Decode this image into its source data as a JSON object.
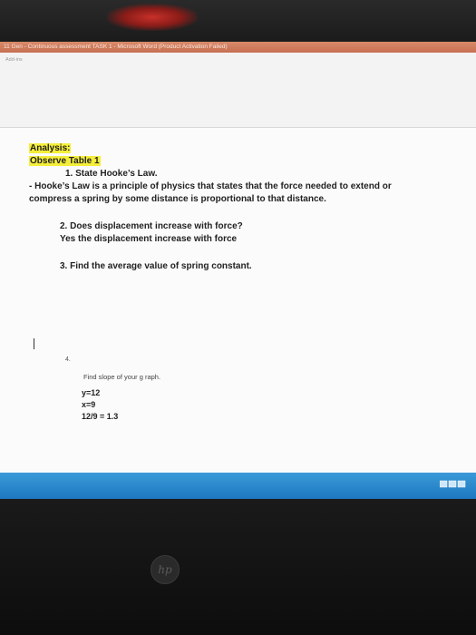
{
  "titlebar": {
    "text": "11 Gen - Continuous assessment TASK 1 - Microsoft Word (Product Activation Failed)"
  },
  "ribbon": {
    "label": "Add-ins"
  },
  "document": {
    "heading1": "Analysis:",
    "heading2": "Observe Table 1",
    "q1": "1.  State Hooke’s Law.",
    "a1_line1": "- Hooke’s Law is a principle of physics that states that the force needed to extend or",
    "a1_line2": "compress a spring by some distance is proportional to that distance.",
    "q2": "2.  Does displacement increase with force?",
    "a2": "Yes the displacement increase with force",
    "q3": "3.  Find the average value of spring constant.",
    "q4_number": "4.",
    "q4_text": "Find slope of your g raph.",
    "calc_y": "y=12",
    "calc_x": "x=9",
    "calc_result": "12/9 = 1.3"
  },
  "colors": {
    "highlight": "#f4ee3a",
    "taskbar": "#2a86cc",
    "titlebar": "#c86f52"
  },
  "logo": {
    "text": "hp"
  }
}
